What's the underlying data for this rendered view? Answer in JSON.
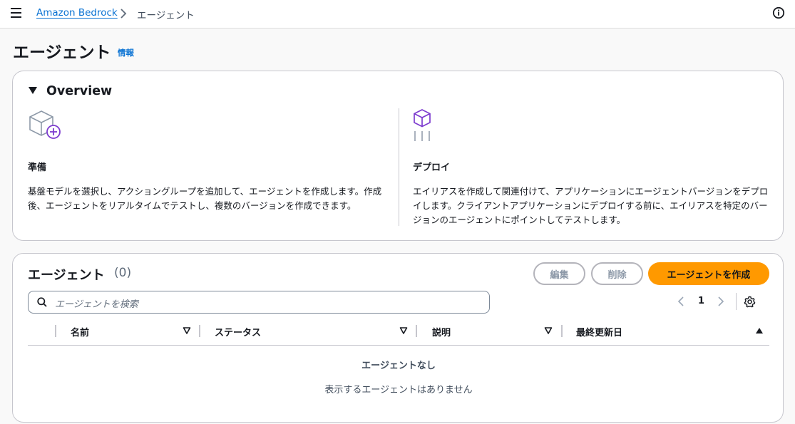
{
  "breadcrumb": {
    "root": "Amazon Bedrock",
    "current": "エージェント"
  },
  "header": {
    "title": "エージェント",
    "info_link": "情報"
  },
  "overview": {
    "title": "Overview",
    "prepare": {
      "heading": "準備",
      "text": "基盤モデルを選択し、アクショングループを追加して、エージェントを作成します。作成後、エージェントをリアルタイムでテストし、複数のバージョンを作成できます。",
      "icon": "cube-add-icon"
    },
    "deploy": {
      "heading": "デプロイ",
      "text": "エイリアスを作成して関連付けて、アプリケーションにエージェントバージョンをデプロイします。クライアントアプリケーションにデプロイする前に、エイリアスを特定のバージョンのエージェントにポイントしてテストします。",
      "icon": "cube-deploy-icon"
    }
  },
  "agents": {
    "title": "エージェント",
    "count": "(0)",
    "buttons": {
      "edit": "編集",
      "delete": "削除",
      "create": "エージェントを作成"
    },
    "search_placeholder": "エージェントを検索",
    "pagination": {
      "current_page": "1"
    },
    "columns": [
      "名前",
      "ステータス",
      "説明",
      "最終更新日"
    ],
    "empty_title": "エージェントなし",
    "empty_text": "表示するエージェントはありません"
  },
  "colors": {
    "accent": "#0972d3",
    "primary_button": "#ff9900",
    "icon_purple": "#7d3ccf"
  }
}
